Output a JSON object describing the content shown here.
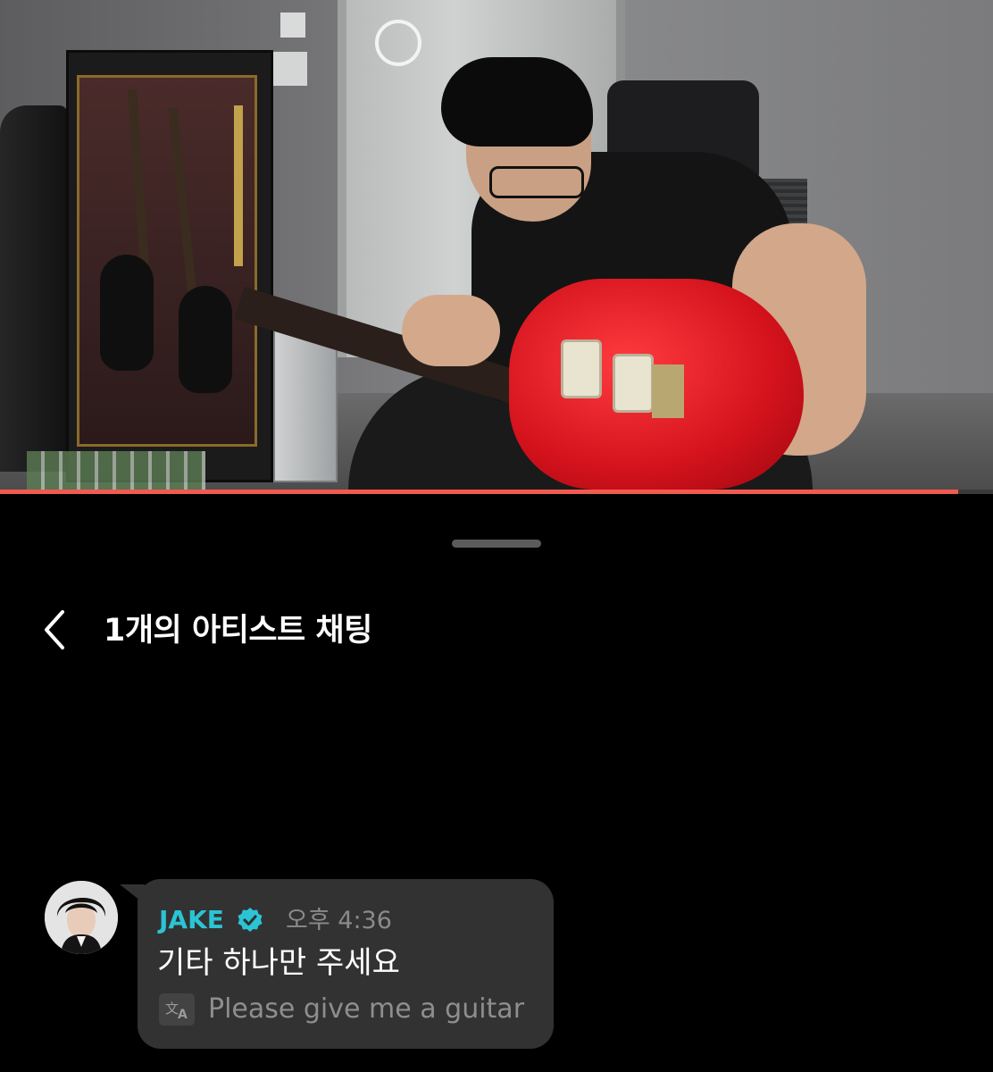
{
  "video": {
    "progress": 0.965,
    "accent_color": "#f25a50"
  },
  "header": {
    "title": "1개의 아티스트 채팅",
    "back_icon": "chevron-left-icon"
  },
  "messages": [
    {
      "author": "JAKE",
      "verified": true,
      "time": "오후 4:36",
      "text": "기타 하나만 주세요",
      "translation": "Please give me a guitar",
      "name_color": "#2bc4d4"
    }
  ]
}
